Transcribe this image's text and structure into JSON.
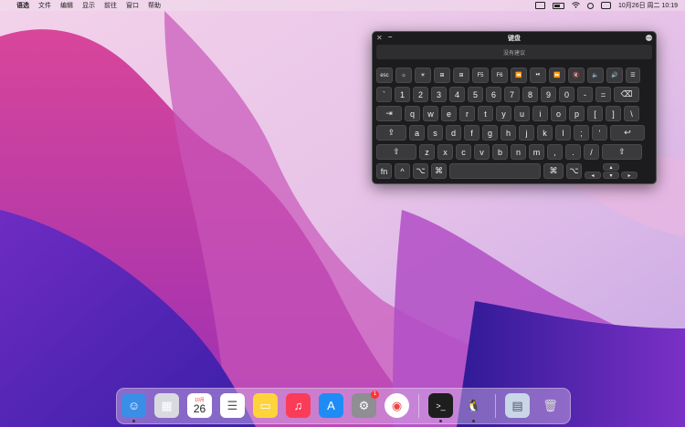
{
  "menubar": {
    "apple": "",
    "app_name": "语选",
    "menus": [
      "文件",
      "编辑",
      "显示",
      "前往",
      "窗口",
      "帮助"
    ],
    "clock": "10月26日 周二  10:19"
  },
  "keyboard_window": {
    "title": "键盘",
    "suggestion": "没有建议",
    "rows": {
      "fn_row": [
        "esc",
        "☼",
        "☀",
        "⊞",
        "⊞",
        "F5",
        "F6",
        "⏪",
        "⏯",
        "⏩",
        "🔇",
        "🔈",
        "🔊",
        "☰"
      ],
      "num_row": [
        "`",
        "1",
        "2",
        "3",
        "4",
        "5",
        "6",
        "7",
        "8",
        "9",
        "0",
        "-",
        "=",
        "⌫"
      ],
      "q_row": [
        "⇥",
        "q",
        "w",
        "e",
        "r",
        "t",
        "y",
        "u",
        "i",
        "o",
        "p",
        "[",
        "]",
        "\\"
      ],
      "a_row": [
        "⇪",
        "a",
        "s",
        "d",
        "f",
        "g",
        "h",
        "j",
        "k",
        "l",
        ";",
        "'",
        "↩"
      ],
      "z_row": [
        "⇧",
        "z",
        "x",
        "c",
        "v",
        "b",
        "n",
        "m",
        ",",
        ".",
        "/",
        "⇧"
      ],
      "bottom_row": [
        "fn",
        "^",
        "⌥",
        "⌘",
        "",
        "⌘",
        "⌥"
      ],
      "arrows": [
        "◂",
        "▴",
        "▾",
        "▸"
      ]
    }
  },
  "dock": {
    "apps": [
      {
        "name": "Finder",
        "glyph": "☺",
        "color": "#3a8ee6"
      },
      {
        "name": "Launchpad",
        "glyph": "▦",
        "color": "#d9d9e0"
      },
      {
        "name": "Calendar",
        "month": "10月",
        "day": "26",
        "color": "#ffffff"
      },
      {
        "name": "Reminders",
        "glyph": "☰",
        "color": "#ffffff"
      },
      {
        "name": "Notes",
        "glyph": "▭",
        "color": "#ffd43b"
      },
      {
        "name": "Music",
        "glyph": "♫",
        "color": "#fa3c58"
      },
      {
        "name": "App Store",
        "glyph": "A",
        "color": "#1f8cf5"
      },
      {
        "name": "System Preferences",
        "glyph": "⚙",
        "color": "#8e8e93",
        "badge": "1"
      },
      {
        "name": "Chrome",
        "glyph": "◉",
        "color": "#ffffff"
      },
      {
        "name": "Terminal",
        "glyph": ">_",
        "color": "#1e1e1e"
      },
      {
        "name": "QQ",
        "glyph": "🐧",
        "color": "transparent"
      },
      {
        "name": "Documents",
        "glyph": "▤",
        "color": "#c8d6e8"
      },
      {
        "name": "Trash",
        "glyph": "🗑",
        "color": "transparent"
      }
    ]
  }
}
